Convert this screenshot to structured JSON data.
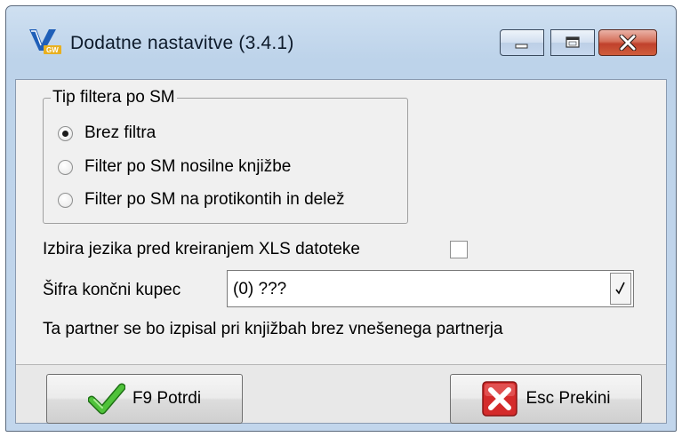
{
  "window": {
    "title": "Dodatne nastavitve  (3.4.1)",
    "app_icon": "app-logo-icon",
    "controls": [
      "minimize-icon",
      "maximize-icon",
      "close-icon"
    ]
  },
  "filter_group": {
    "legend": "Tip filtera po SM",
    "options": [
      {
        "label": "Brez filtra",
        "selected": true
      },
      {
        "label": "Filter po SM nosilne knjižbe",
        "selected": false
      },
      {
        "label": "Filter po SM na protikontih in delež",
        "selected": false
      }
    ]
  },
  "language_option": {
    "label": "Izbira jezika pred kreiranjem XLS datoteke",
    "checked": false
  },
  "customer": {
    "label": "Šifra končni kupec",
    "value": "(0) ???",
    "dropdown_icon": "checkmark-icon",
    "hint": "Ta partner se bo izpisal pri knjižbah brez vnešenega partnerja"
  },
  "buttons": {
    "confirm_label": "F9 Potrdi",
    "confirm_icon": "green-check-icon",
    "cancel_label": "Esc Prekini",
    "cancel_icon": "red-x-icon"
  },
  "colors": {
    "title_bar": "#c5d8ee",
    "close_button": "#c7482f",
    "confirm_check": "#3dab2a",
    "cancel_x": "#d42b2b"
  }
}
